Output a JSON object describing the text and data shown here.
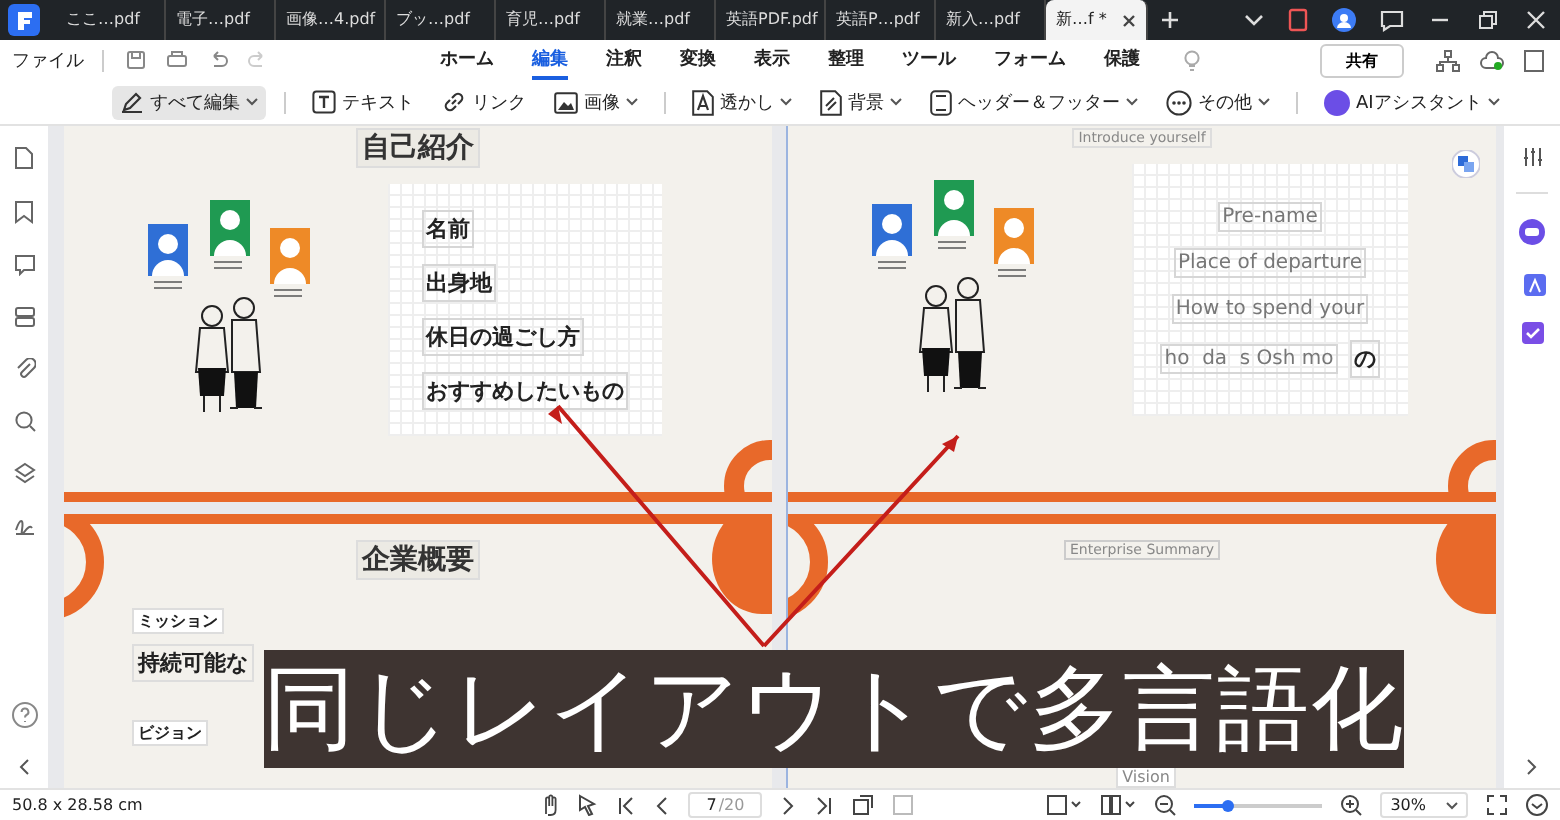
{
  "tabs": [
    {
      "label": "ここ…pdf",
      "selected": false
    },
    {
      "label": "電子…pdf",
      "selected": false
    },
    {
      "label": "画像…4.pdf",
      "selected": false
    },
    {
      "label": "ブッ…pdf",
      "selected": false
    },
    {
      "label": "育児…pdf",
      "selected": false
    },
    {
      "label": "就業…pdf",
      "selected": false
    },
    {
      "label": "英語PDF.pdf",
      "selected": false
    },
    {
      "label": "英語P…pdf",
      "selected": false
    },
    {
      "label": "新入…pdf",
      "selected": false
    },
    {
      "label": "新…f *",
      "selected": true
    }
  ],
  "menu": {
    "file": "ファイル",
    "share": "共有",
    "items": [
      {
        "label": "ホーム",
        "selected": false
      },
      {
        "label": "編集",
        "selected": true
      },
      {
        "label": "注釈",
        "selected": false
      },
      {
        "label": "変換",
        "selected": false
      },
      {
        "label": "表示",
        "selected": false
      },
      {
        "label": "整理",
        "selected": false
      },
      {
        "label": "ツール",
        "selected": false
      },
      {
        "label": "フォーム",
        "selected": false
      },
      {
        "label": "保護",
        "selected": false
      }
    ]
  },
  "toolbar": [
    {
      "kind": "edit",
      "label": "すべて編集",
      "selected": true,
      "dropdown": true
    },
    {
      "kind": "text",
      "label": "テキスト",
      "selected": false,
      "dropdown": false
    },
    {
      "kind": "link",
      "label": "リンク",
      "selected": false,
      "dropdown": false
    },
    {
      "kind": "image",
      "label": "画像",
      "selected": false,
      "dropdown": true
    },
    {
      "kind": "watermark",
      "label": "透かし",
      "selected": false,
      "dropdown": true
    },
    {
      "kind": "background",
      "label": "背景",
      "selected": false,
      "dropdown": true
    },
    {
      "kind": "header",
      "label": "ヘッダー＆フッター",
      "selected": false,
      "dropdown": true
    },
    {
      "kind": "more",
      "label": "その他",
      "selected": false,
      "dropdown": true
    },
    {
      "kind": "ai",
      "label": "AIアシスタント",
      "selected": false,
      "dropdown": true
    }
  ],
  "pages": [
    {
      "title": "自己紹介",
      "fields": [
        "名前",
        "出身地",
        "休日の過ごし方",
        "おすすめしたいもの"
      ],
      "section": "企業概要",
      "mission_label": "ミッション",
      "mission_text": "持続可能な",
      "vision_label": "ビジョン"
    },
    {
      "title": "Introduce yourself",
      "fields": [
        "Pre-name",
        "Place of departure",
        "How to spend your",
        "ho  da  s Osh mo"
      ],
      "extra": "の",
      "section": "Enterprise Summary",
      "vision_label": "Vision"
    }
  ],
  "caption": "同じレイアウトで多言語化",
  "status": {
    "size": "50.8 x 28.58 cm",
    "page": "7",
    "total": "/20",
    "zoom": "30%",
    "level": 0.27
  }
}
